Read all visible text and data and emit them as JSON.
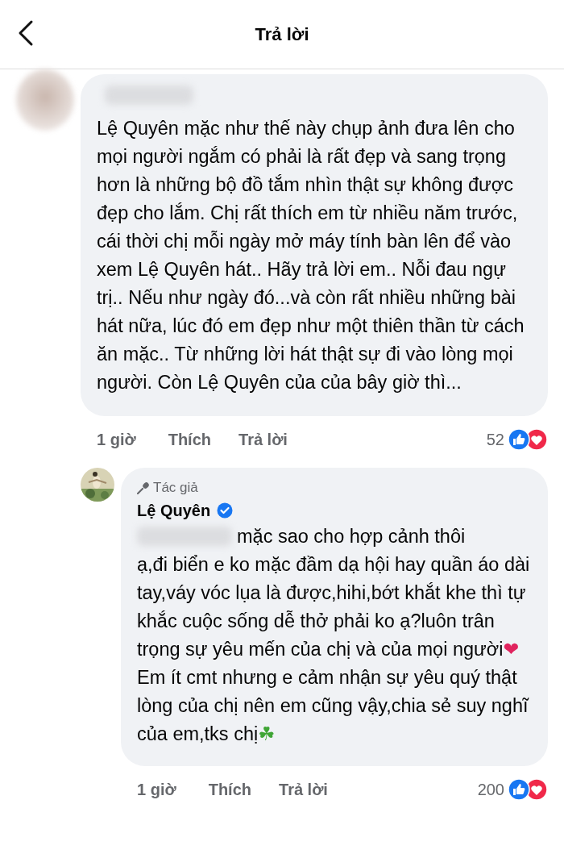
{
  "header": {
    "title": "Trả lời"
  },
  "comment": {
    "text": "Lệ Quyên mặc như thế này chụp ảnh đưa lên cho mọi người ngắm có phải là rất đẹp và sang trọng hơn là những bộ đồ tắm nhìn thật sự không được đẹp cho lắm. Chị rất thích em từ nhiều năm trước, cái thời chị mỗi ngày mở máy tính bàn lên để vào xem Lệ Quyên hát.. Hãy trả lời em.. Nỗi đau ngự trị.. Nếu như ngày đó...và còn rất nhiều những bài hát nữa, lúc đó em đẹp như một thiên thần từ cách ăn mặc.. Từ những lời hát thật sự đi vào lòng mọi người. Còn Lệ Quyên của của bây giờ thì...",
    "time": "1 giờ",
    "actions": [
      "Thích",
      "Trả lời"
    ],
    "reaction_count": "52"
  },
  "reply": {
    "badge": "Tác giả",
    "author": "Lệ Quyên",
    "verified": true,
    "first_line": "mặc sao cho hợp cảnh thôi",
    "text": [
      {
        "kind": "text",
        "text": "ạ,đi biển e ko mặc đầm dạ hội hay quần áo dài tay,váy vóc lụa là được,hihi,bớt khắt khe thì tự khắc cuộc sống dễ thở phải ko ạ?luôn trân trọng sự yêu mến của chị và của mọi người"
      },
      {
        "kind": "emoji",
        "text": "❤",
        "color": "#e0245e"
      },
      {
        "kind": "text",
        "text": "Em ít cmt nhưng e cảm nhận sự yêu quý thật lòng của chị nên em cũng vậy,chia sẻ suy nghĩ của em,tks chị"
      },
      {
        "kind": "emoji",
        "text": "☘",
        "color": "#3fa535"
      }
    ],
    "time": "1 giờ",
    "actions": [
      "Thích",
      "Trả lời"
    ],
    "reaction_count": "200"
  }
}
